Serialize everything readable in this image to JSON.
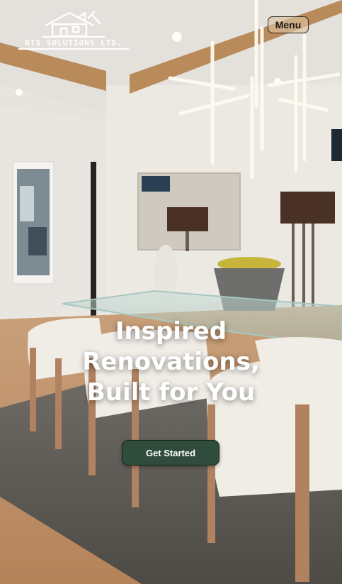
{
  "brand": {
    "name": "RTS SOLUTIONS LTD."
  },
  "header": {
    "menu_label": "Menu"
  },
  "hero": {
    "headline_lines": [
      "Inspired",
      "Renovations,",
      "Built for You"
    ],
    "cta_label": "Get Started"
  },
  "colors": {
    "cta_bg": "#2f4c3c",
    "menu_bg": "#d9bf9d",
    "beam": "#b98a5a"
  }
}
